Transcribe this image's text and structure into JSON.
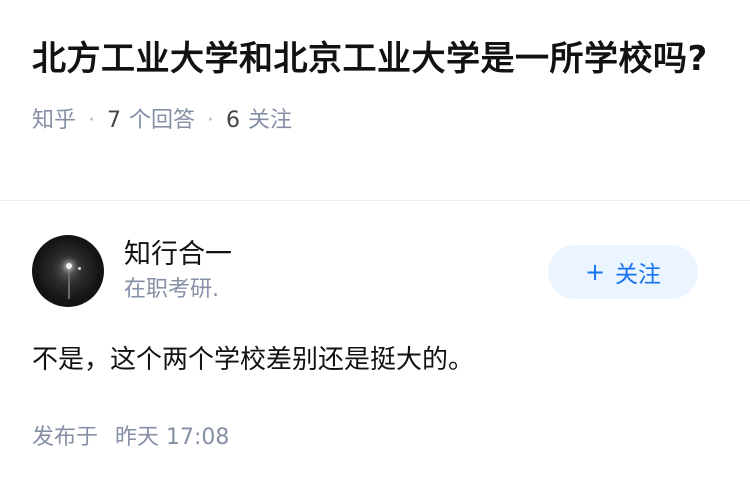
{
  "question": {
    "title": "北方工业大学和北京工业大学是一所学校吗?",
    "source": "知乎",
    "answer_count": "7",
    "answer_label": "个回答",
    "follower_count": "6",
    "follower_label": "关注",
    "separator": "·"
  },
  "answer": {
    "author": {
      "name": "知行合一",
      "description": "在职考研.",
      "avatar_icon": "night-street-lamp-avatar"
    },
    "follow_button": {
      "icon": "+",
      "label": "关注"
    },
    "content": "不是，这个两个学校差别还是挺大的。",
    "footer": {
      "published_label": "发布于",
      "time": "昨天 17:08"
    }
  },
  "colors": {
    "accent": "#1772f6",
    "button_bg": "#ebf5ff",
    "meta_text": "#8590a6",
    "primary_text": "#121212"
  }
}
